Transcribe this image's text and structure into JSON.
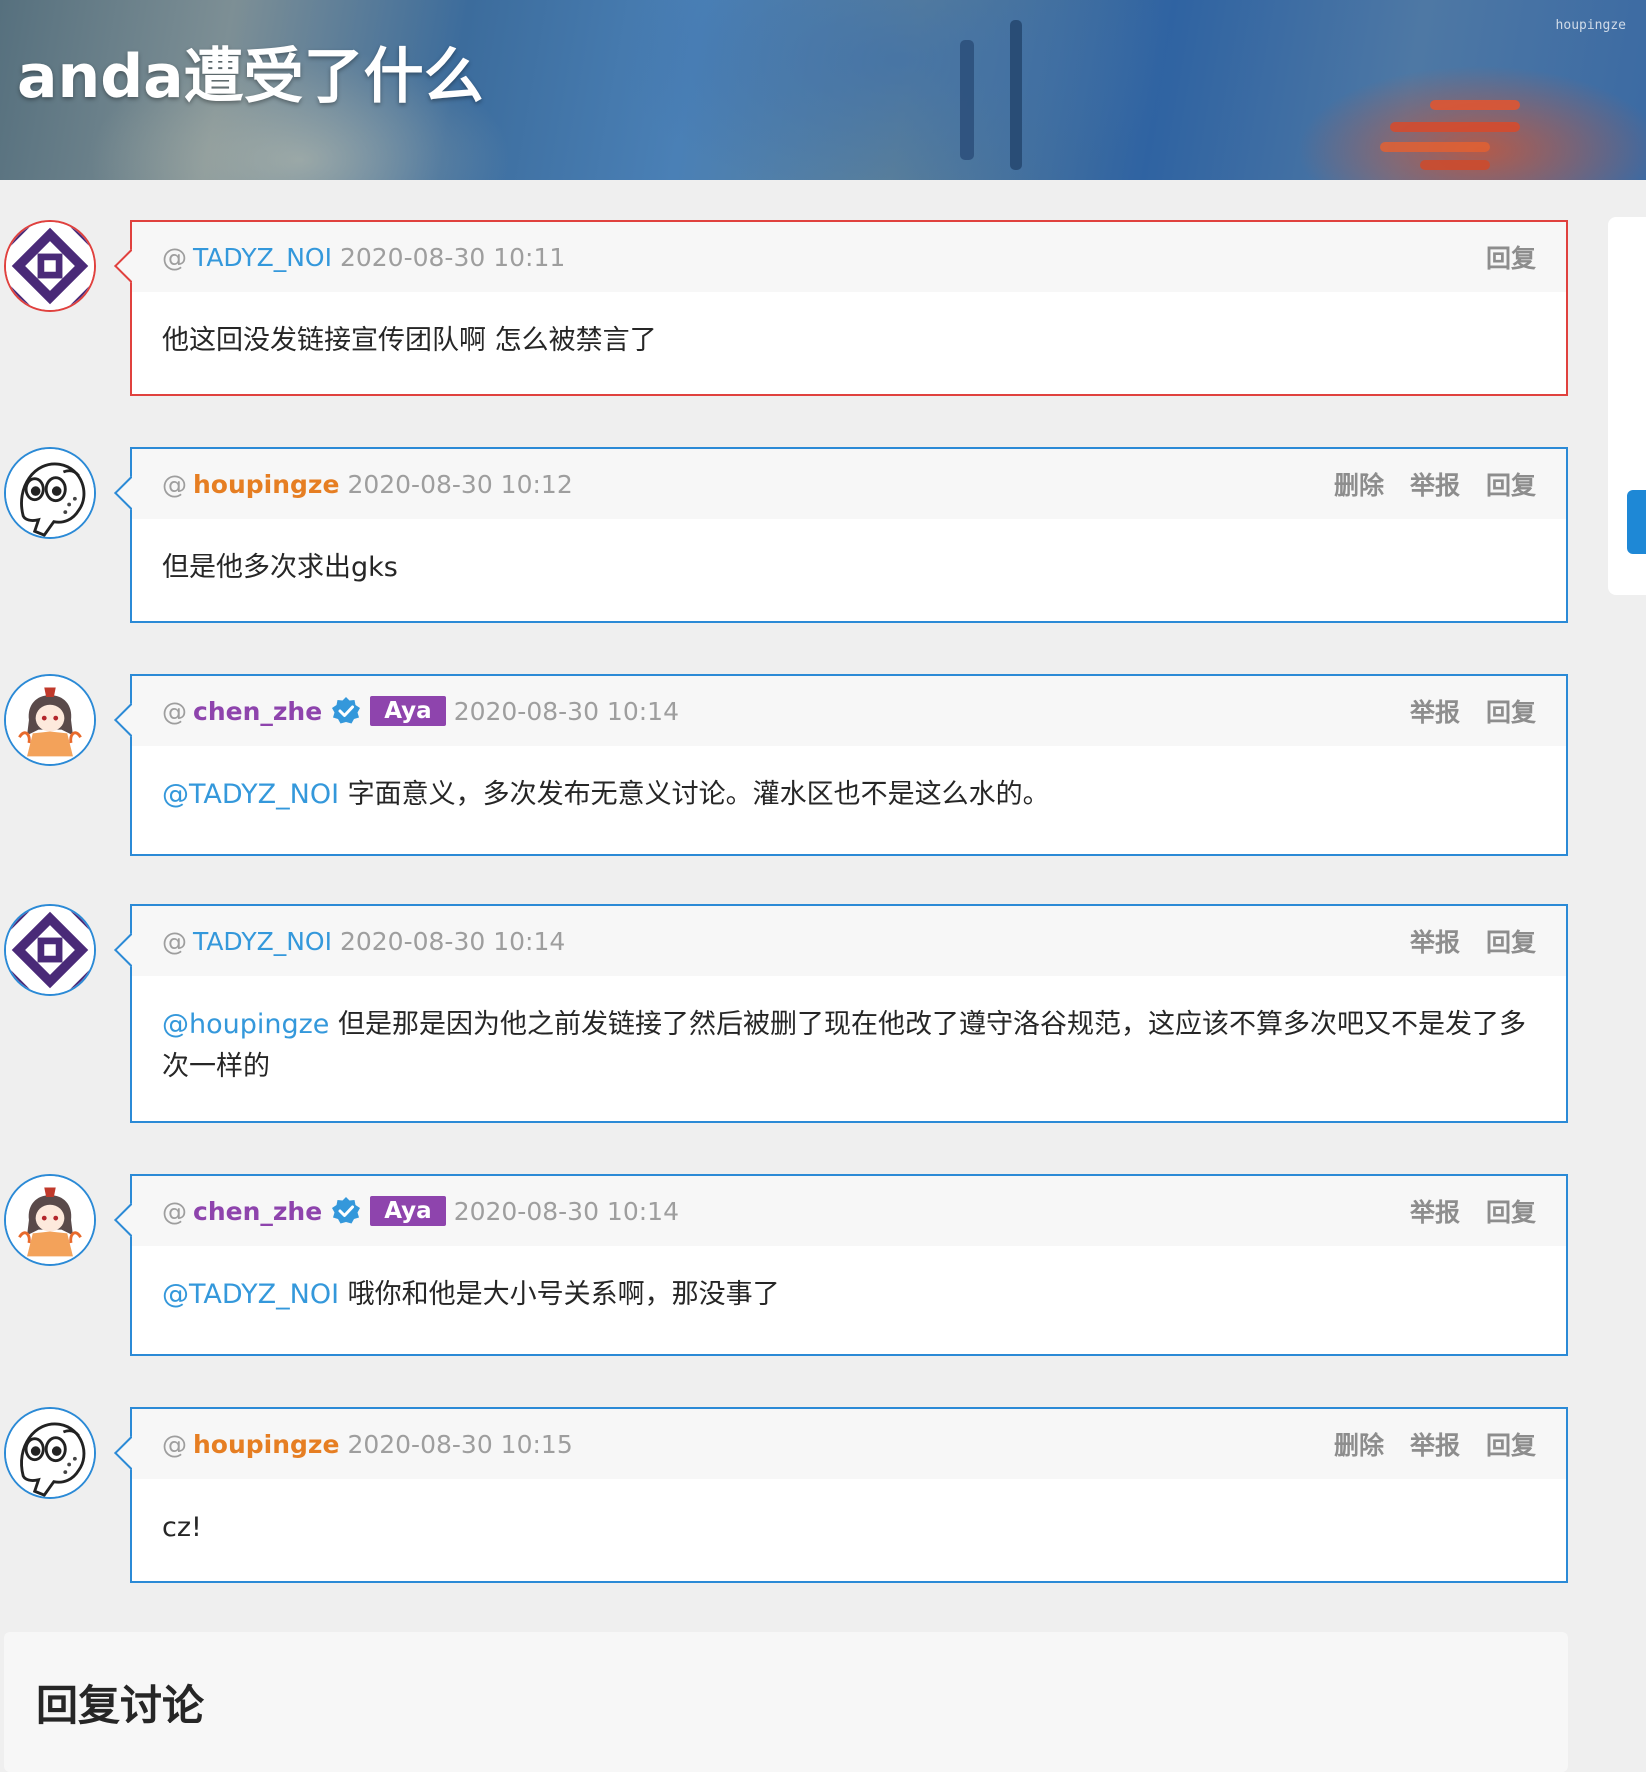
{
  "page": {
    "title": "anda遭受了什么",
    "banner_user": "houpingze"
  },
  "labels": {
    "at": "@",
    "reply": "回复",
    "report": "举报",
    "delete": "删除"
  },
  "comments": [
    {
      "user": "TADYZ_NOI",
      "time": "2020-08-30 10:11",
      "mention": "",
      "text": "他这回没发链接宣传团队啊 怎么被禁言了"
    },
    {
      "user": "houpingze",
      "time": "2020-08-30 10:12",
      "mention": "",
      "text": "但是他多次求出gks"
    },
    {
      "user": "chen_zhe",
      "tag": "Aya",
      "time": "2020-08-30 10:14",
      "mention": "@TADYZ_NOI",
      "text": " 字面意义，多次发布无意义讨论。灌水区也不是这么水的。"
    },
    {
      "user": "TADYZ_NOI",
      "time": "2020-08-30 10:14",
      "mention": "@houpingze",
      "text": " 但是那是因为他之前发链接了然后被删了现在他改了遵守洛谷规范，这应该不算多次吧又不是发了多次一样的"
    },
    {
      "user": "chen_zhe",
      "tag": "Aya",
      "time": "2020-08-30 10:14",
      "mention": "@TADYZ_NOI",
      "text": " 哦你和他是大小号关系啊，那没事了"
    },
    {
      "user": "houpingze",
      "time": "2020-08-30 10:15",
      "mention": "",
      "text": "cz!"
    }
  ],
  "reply_section": {
    "heading": "回复讨论"
  },
  "colors": {
    "link_blue": "#3498db",
    "name_orange": "#e67e22",
    "name_purple": "#8e44ad",
    "card_border": "#2b8ad6",
    "highlight_border": "#e0413e"
  },
  "icons": {
    "verified": "verified-badge-icon"
  }
}
